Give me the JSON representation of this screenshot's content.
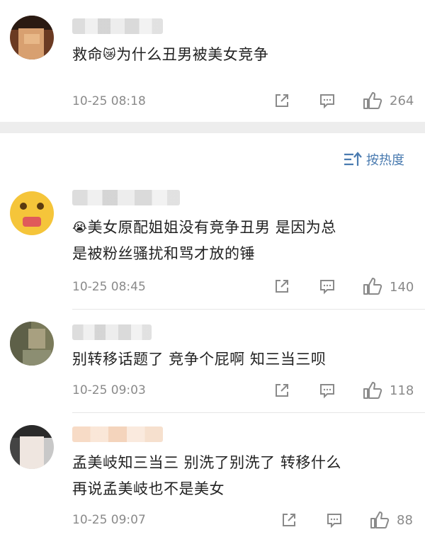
{
  "post": {
    "text_before": "救命",
    "emoji_icon": "crying-cat-emoji",
    "text_after": "为什么丑男被美女竞争",
    "time": "10-25 08:18",
    "like_count": "264"
  },
  "sort": {
    "label": "按热度"
  },
  "comments": [
    {
      "emoji_icon": "loudly-crying-face-emoji",
      "line1": "美女原配姐姐没有竞争丑男 是因为总",
      "line2": "是被粉丝骚扰和骂才放的锤",
      "time": "10-25 08:45",
      "like_count": "140"
    },
    {
      "line1": "别转移话题了  竞争个屁啊  知三当三呗",
      "time": "10-25 09:03",
      "like_count": "118"
    },
    {
      "line1": "孟美岐知三当三 别洗了别洗了 转移什么",
      "line2": "再说孟美岐也不是美女",
      "time": "10-25 09:07",
      "like_count": "88"
    }
  ],
  "colors": {
    "link": "#4a7bb0",
    "meta": "#8a8a8a",
    "divider": "#ededed"
  }
}
